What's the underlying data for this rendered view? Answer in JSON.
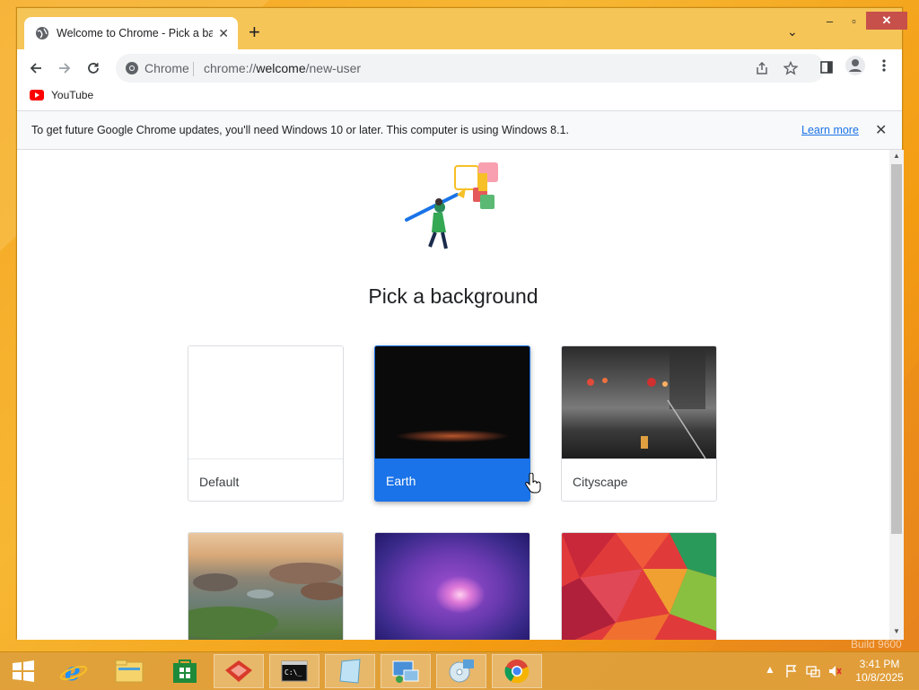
{
  "browser": {
    "tab_title": "Welcome to Chrome - Pick a bac",
    "site_label": "Chrome",
    "url_prefix": "chrome://",
    "url_host": "welcome",
    "url_path": "/new-user"
  },
  "bookmarks": [
    {
      "label": "YouTube"
    }
  ],
  "infobar": {
    "message": "To get future Google Chrome updates, you'll need Windows 10 or later. This computer is using Windows 8.1.",
    "link": "Learn more"
  },
  "page": {
    "heading": "Pick a background",
    "backgrounds": [
      {
        "label": "Default",
        "selected": false
      },
      {
        "label": "Earth",
        "selected": true
      },
      {
        "label": "Cityscape",
        "selected": false
      },
      {
        "label": "",
        "selected": false
      },
      {
        "label": "",
        "selected": false
      },
      {
        "label": "",
        "selected": false
      }
    ]
  },
  "taskbar": {
    "time": "3:41 PM",
    "date": "10/8/2025",
    "watermark": "Build 9600",
    "apps": [
      "start-button",
      "internet-explorer",
      "file-explorer",
      "store",
      "app-red",
      "command-prompt",
      "notepad",
      "control-panel",
      "media",
      "chrome"
    ]
  },
  "colors": {
    "accent": "#1a73e8",
    "titlebar": "#f6c557",
    "taskbar": "#dea03c"
  }
}
